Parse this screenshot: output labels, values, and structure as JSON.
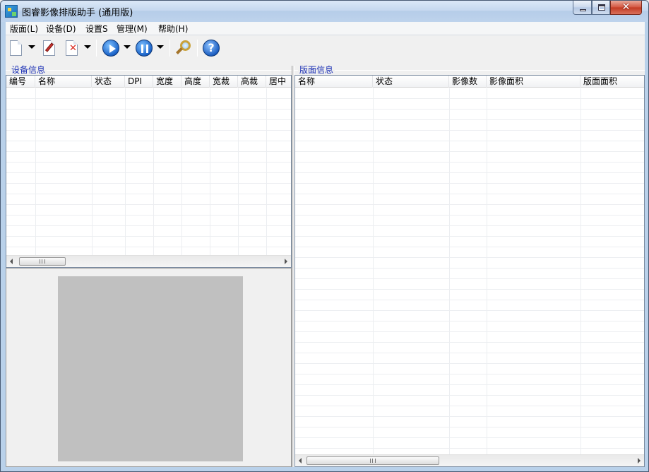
{
  "window": {
    "title": "图睿影像排版助手 (通用版)",
    "close_glyph": "✕"
  },
  "menu": [
    {
      "label": "版面(L)"
    },
    {
      "label": "设备(D)"
    },
    {
      "label": "设置S"
    },
    {
      "label": "管理(M)"
    },
    {
      "label": "帮助(H)"
    }
  ],
  "toolbar": {
    "icons": [
      "new-document-icon",
      "edit-icon",
      "delete-icon",
      "play-icon",
      "pause-icon",
      "search-icon",
      "help-icon"
    ],
    "help_glyph": "?"
  },
  "device_panel": {
    "title": "设备信息",
    "columns": [
      "编号",
      "名称",
      "状态",
      "DPI",
      "宽度",
      "高度",
      "宽裁",
      "高裁",
      "居中"
    ]
  },
  "layout_panel": {
    "title": "版面信息",
    "columns": [
      "名称",
      "状态",
      "影像数",
      "影像面积",
      "版面面积"
    ]
  },
  "colors": {
    "group_title": "#1a2fb4",
    "preview_canvas": "#c0c0c0",
    "title_bar": "#c6d9ef",
    "close_button": "#c23a22"
  }
}
